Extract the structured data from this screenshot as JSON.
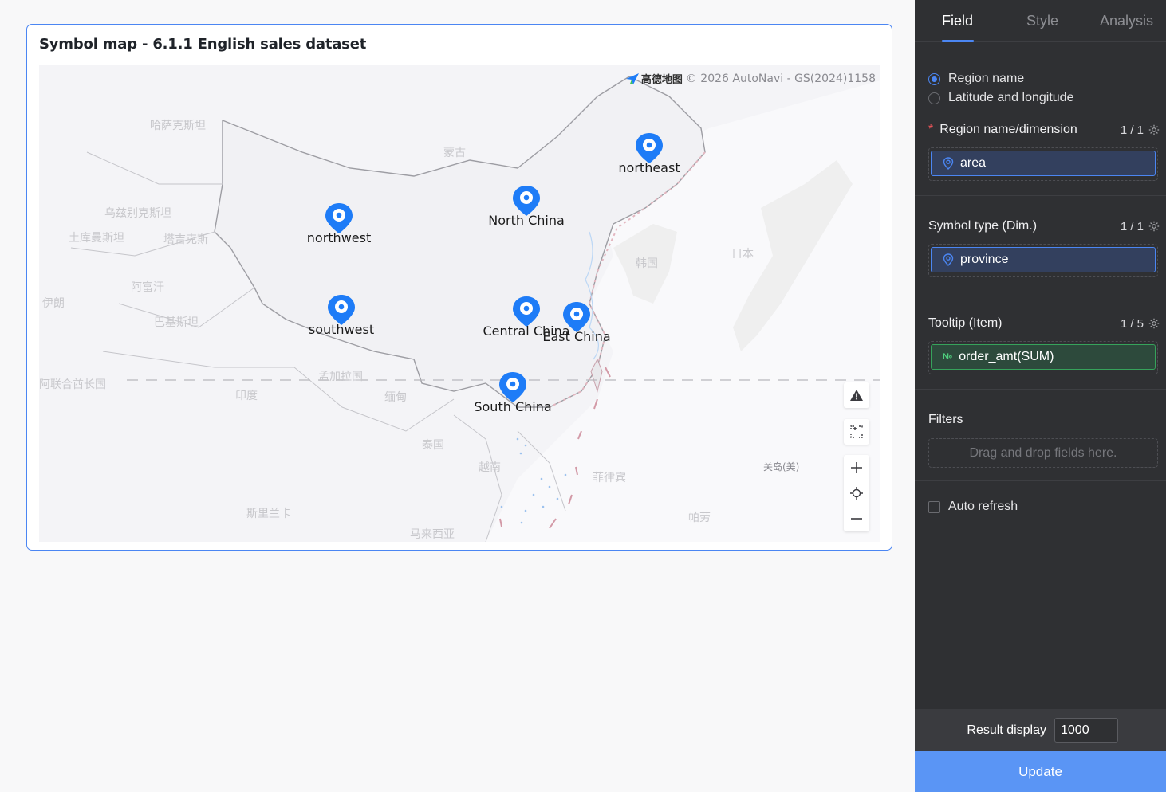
{
  "chart_card": {
    "title": "Symbol map - 6.1.1 English sales dataset"
  },
  "map": {
    "copyright": "© 2026 AutoNavi - GS(2024)1158",
    "provider_logo_text": "高德地图",
    "marker_color": "#1e7cf7",
    "geo_labels": [
      "哈萨克斯坦",
      "蒙古",
      "乌兹别克斯坦",
      "土库曼斯坦",
      "塔吉克斯",
      "阿富汗",
      "伊朗",
      "巴基斯坦",
      "阿联合酋长国",
      "印度",
      "孟加拉国",
      "缅甸",
      "泰国",
      "越南",
      "菲律宾",
      "斯里兰卡",
      "马来西亚",
      "帕劳",
      "关岛(美)",
      "韩国",
      "日本"
    ],
    "markers": [
      {
        "label": "northeast"
      },
      {
        "label": "North China"
      },
      {
        "label": "northwest"
      },
      {
        "label": "southwest"
      },
      {
        "label": "Central China"
      },
      {
        "label": "East China"
      },
      {
        "label": "South China"
      }
    ],
    "controls": {
      "warning_icon": "warning-icon",
      "fit_icon": "fit-bounds-icon",
      "zoom_in_icon": "plus-icon",
      "locate_icon": "locate-icon",
      "zoom_out_icon": "minus-icon"
    }
  },
  "panel": {
    "tabs": [
      {
        "label": "Field",
        "active": true
      },
      {
        "label": "Style",
        "active": false
      },
      {
        "label": "Analysis",
        "active": false
      }
    ],
    "location_mode": {
      "options": [
        "Region name",
        "Latitude and longitude"
      ],
      "selected": "Region name"
    },
    "region_section": {
      "required_mark": "*",
      "title": "Region name/dimension",
      "count": "1 / 1",
      "chip": "area"
    },
    "symbol_section": {
      "title": "Symbol type (Dim.)",
      "count": "1 / 1",
      "chip": "province"
    },
    "tooltip_section": {
      "title": "Tooltip (Item)",
      "count": "1 / 5",
      "chip": "order_amt(SUM)",
      "chip_type_icon": "№"
    },
    "filters": {
      "title": "Filters",
      "placeholder": "Drag and drop fields here."
    },
    "auto_refresh": {
      "label": "Auto refresh",
      "checked": false
    },
    "result_display": {
      "label": "Result display",
      "value": "1000"
    },
    "update_button": "Update",
    "accent_color": "#4b86f3"
  }
}
